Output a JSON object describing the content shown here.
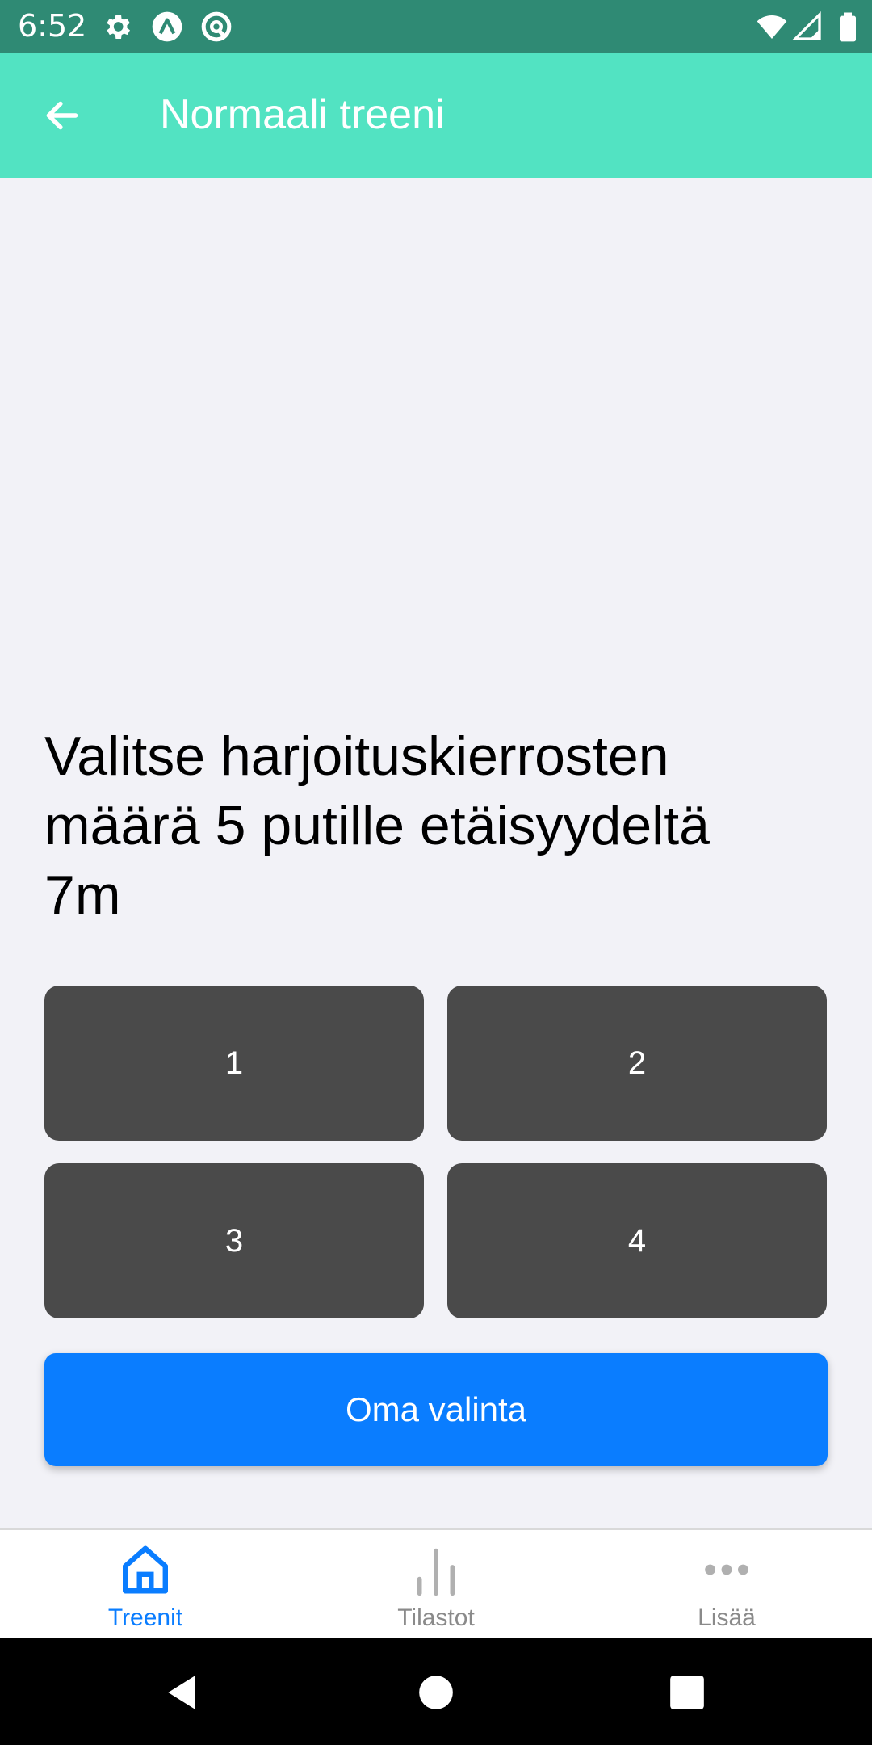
{
  "status_bar": {
    "time": "6:52",
    "left_icons": [
      "gear-icon",
      "arrow-up-circle-icon",
      "at-sign-icon"
    ],
    "right_icons": [
      "wifi-icon",
      "signal-icon",
      "battery-icon"
    ]
  },
  "app_bar": {
    "back_icon": "arrow-left-icon",
    "title": "Normaali treeni",
    "color": "#52e3c2"
  },
  "prompt": {
    "line1": "Valitse harjoituskierrosten",
    "line2": "määrä 5 putille etäisyydeltä",
    "line3": "7m"
  },
  "choices": [
    "1",
    "2",
    "3",
    "4"
  ],
  "custom_button": {
    "label": "Oma valinta",
    "color": "#0a7dff"
  },
  "tab_bar": {
    "tabs": [
      {
        "label": "Treenit",
        "icon": "home-icon",
        "active": true
      },
      {
        "label": "Tilastot",
        "icon": "bar-chart-icon",
        "active": false
      },
      {
        "label": "Lisää",
        "icon": "more-icon",
        "active": false
      }
    ],
    "active_color": "#0a7dff",
    "inactive_color": "#a0a0a0"
  },
  "nav_bar": {
    "buttons": [
      "back-triangle-icon",
      "home-circle-icon",
      "recents-square-icon"
    ]
  }
}
